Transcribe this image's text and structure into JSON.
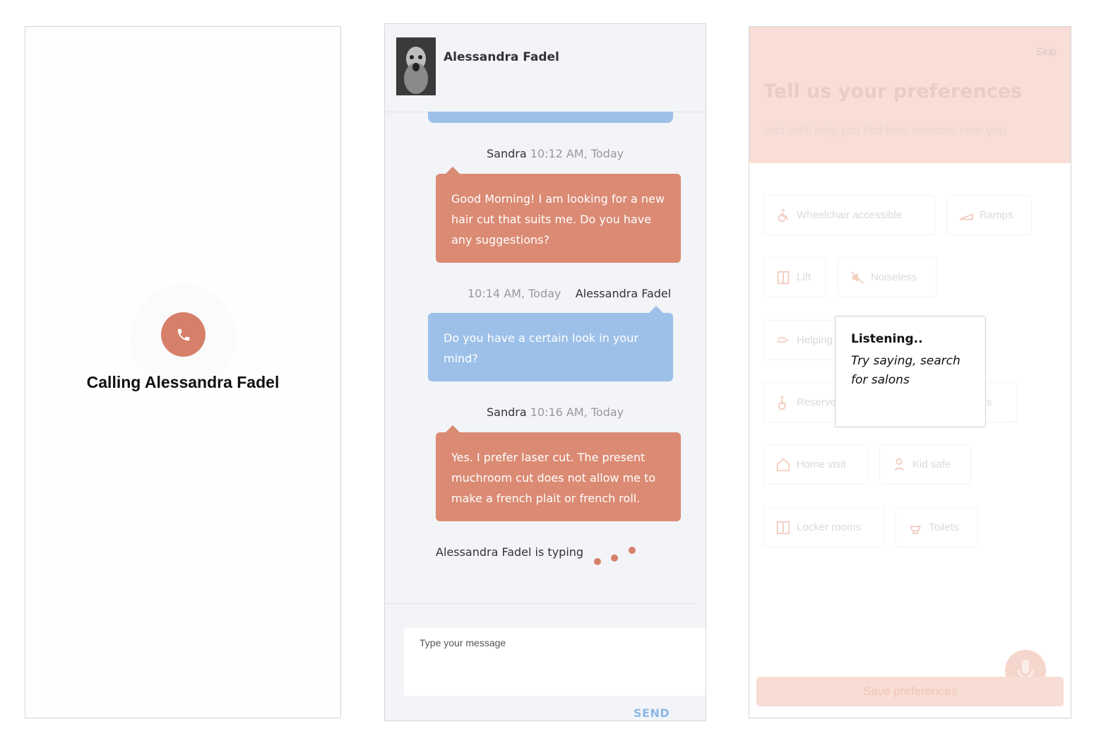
{
  "call_screen": {
    "title": "Calling Alessandra Fadel",
    "icon": "phone-icon",
    "accent_color": "#d6806a"
  },
  "chat": {
    "contact_name": "Alessandra Fadel",
    "messages": [
      {
        "sender": "Sandra",
        "time": "10:12 AM, Today",
        "text": "Good Morning! I am looking for a new hair cut that suits me. Do you have any suggestions?",
        "color": "#db8a73"
      },
      {
        "sender": "Alessandra Fadel",
        "time": "10:14 AM, Today",
        "text": "Do you have a certain look in your mind?",
        "color": "#9dc0e8"
      },
      {
        "sender": "Sandra",
        "time": "10:16 AM, Today",
        "text": "Yes. I prefer laser cut. The present muchroom cut does not allow me to make a french plait or french roll.",
        "color": "#db8a73"
      }
    ],
    "typing_text": "Alessandra Fadel is typing",
    "input_placeholder": "Type your message",
    "send_label": "SEND"
  },
  "preferences": {
    "skip_label": "Skip",
    "title": "Tell us your preferences",
    "subtitle": "And we'll help you find best services near you",
    "options": [
      {
        "label": "Wheelchair accessible",
        "icon": "wheelchair-icon"
      },
      {
        "label": "Ramps",
        "icon": "ramp-icon"
      },
      {
        "label": "Lift",
        "icon": "lift-icon"
      },
      {
        "label": "Noiseless",
        "icon": "mute-icon"
      },
      {
        "label": "Helping",
        "icon": "helping-hand-icon"
      },
      {
        "label": "Reserve",
        "icon": "reserve-icon"
      },
      {
        "label": "ils",
        "icon": ""
      },
      {
        "label": "Home visit",
        "icon": "home-icon"
      },
      {
        "label": "Kid safe",
        "icon": "kid-icon"
      },
      {
        "label": "Locker rooms",
        "icon": "locker-icon"
      },
      {
        "label": "Toilets",
        "icon": "toilet-icon"
      }
    ],
    "listening": {
      "title": "Listening..",
      "hint": "Try saying, search for salons"
    },
    "save_label": "Save preferences",
    "mic_icon": "microphone-icon"
  }
}
